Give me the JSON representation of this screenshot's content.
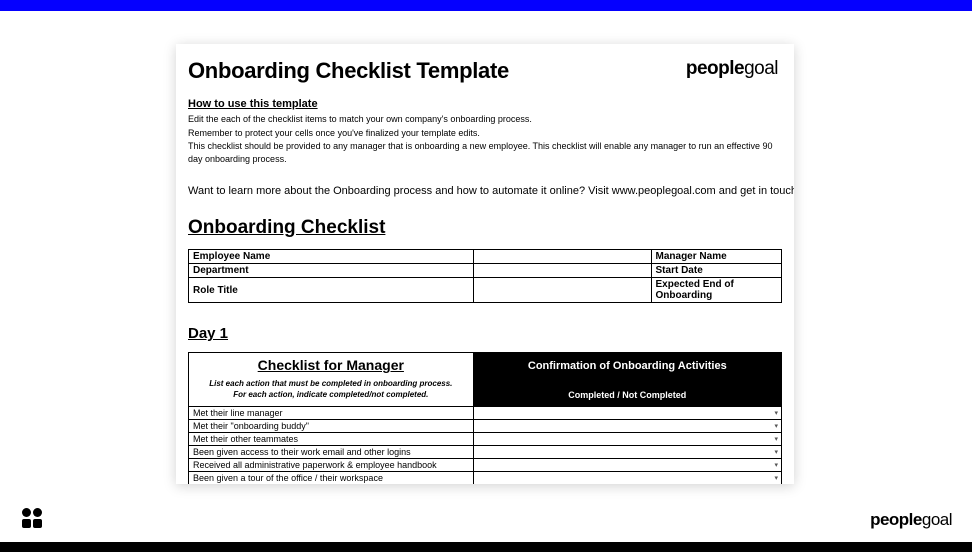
{
  "bars": {
    "top_color": "#0500ff",
    "bottom_color": "#000000"
  },
  "document": {
    "title": "Onboarding Checklist Template",
    "brand": {
      "bold": "people",
      "light": "goal"
    },
    "how_to_use": "How to use this template",
    "instructions": [
      "Edit the each of the checklist items to match your own company's onboarding process.",
      "Remember to protect your cells once you've finalized your template edits.",
      "This checklist should be provided to any manager that is onboarding a new employee. This checklist will enable any manager to run an effective 90 day onboarding process."
    ],
    "learn_more": "Want to learn more about the Onboarding process and how to automate it online? Visit www.peoplegoal.com and get in touch with",
    "section_title": "Onboarding Checklist",
    "info_fields": {
      "employee_name": "Employee Name",
      "manager_name": "Manager Name",
      "department": "Department",
      "start_date": "Start Date",
      "role_title": "Role Title",
      "expected_end": "Expected End of Onboarding"
    },
    "day_title": "Day 1",
    "checklist_header": {
      "left_title": "Checklist for Manager",
      "left_sub1": "List each action that must be completed in onboarding process.",
      "left_sub2": "For each action, indicate completed/not completed.",
      "right_title": "Confirmation of Onboarding Activities",
      "right_sub": "Completed / Not Completed"
    },
    "checklist_items": [
      "Met their line manager",
      "Met their \"onboarding buddy\"",
      "Met their other teammates",
      "Been given access to their work email and other logins",
      "Received all administrative paperwork & employee handbook",
      "Been given a tour of the office / their workspace"
    ]
  },
  "footer": {
    "brand": {
      "bold": "people",
      "light": "goal"
    }
  }
}
